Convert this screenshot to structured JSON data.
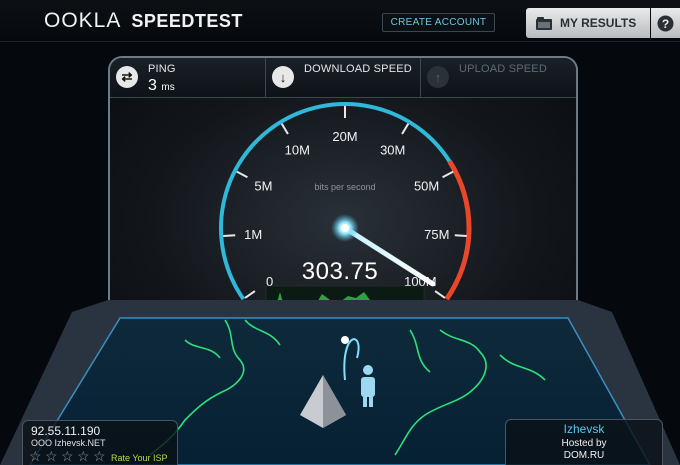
{
  "header": {
    "logo_brand": "OOKLA",
    "logo_product": "SPEEDTEST",
    "create_account_label": "CREATE ACCOUNT",
    "my_results_label": "MY RESULTS",
    "help_label": "?"
  },
  "stats": {
    "ping_label": "PING",
    "ping_value": "3",
    "ping_unit": "ms",
    "download_label": "DOWNLOAD SPEED",
    "upload_label": "UPLOAD SPEED"
  },
  "gauge": {
    "units_label": "bits per second",
    "speed_value": "303.75",
    "ticks": [
      "0",
      "1M",
      "5M",
      "10M",
      "20M",
      "30M",
      "50M",
      "75M",
      "100M"
    ],
    "needle_fraction": 0.99,
    "accent_color": "#2fb8d8",
    "redline_color": "#e8472a"
  },
  "isp": {
    "ip": "92.55.11.190",
    "name": "OOO Izhevsk.NET",
    "rate_label": "Rate Your ISP",
    "stars": 5
  },
  "server": {
    "city": "Izhevsk",
    "hosted_by_label": "Hosted by",
    "host": "DOM.RU"
  }
}
